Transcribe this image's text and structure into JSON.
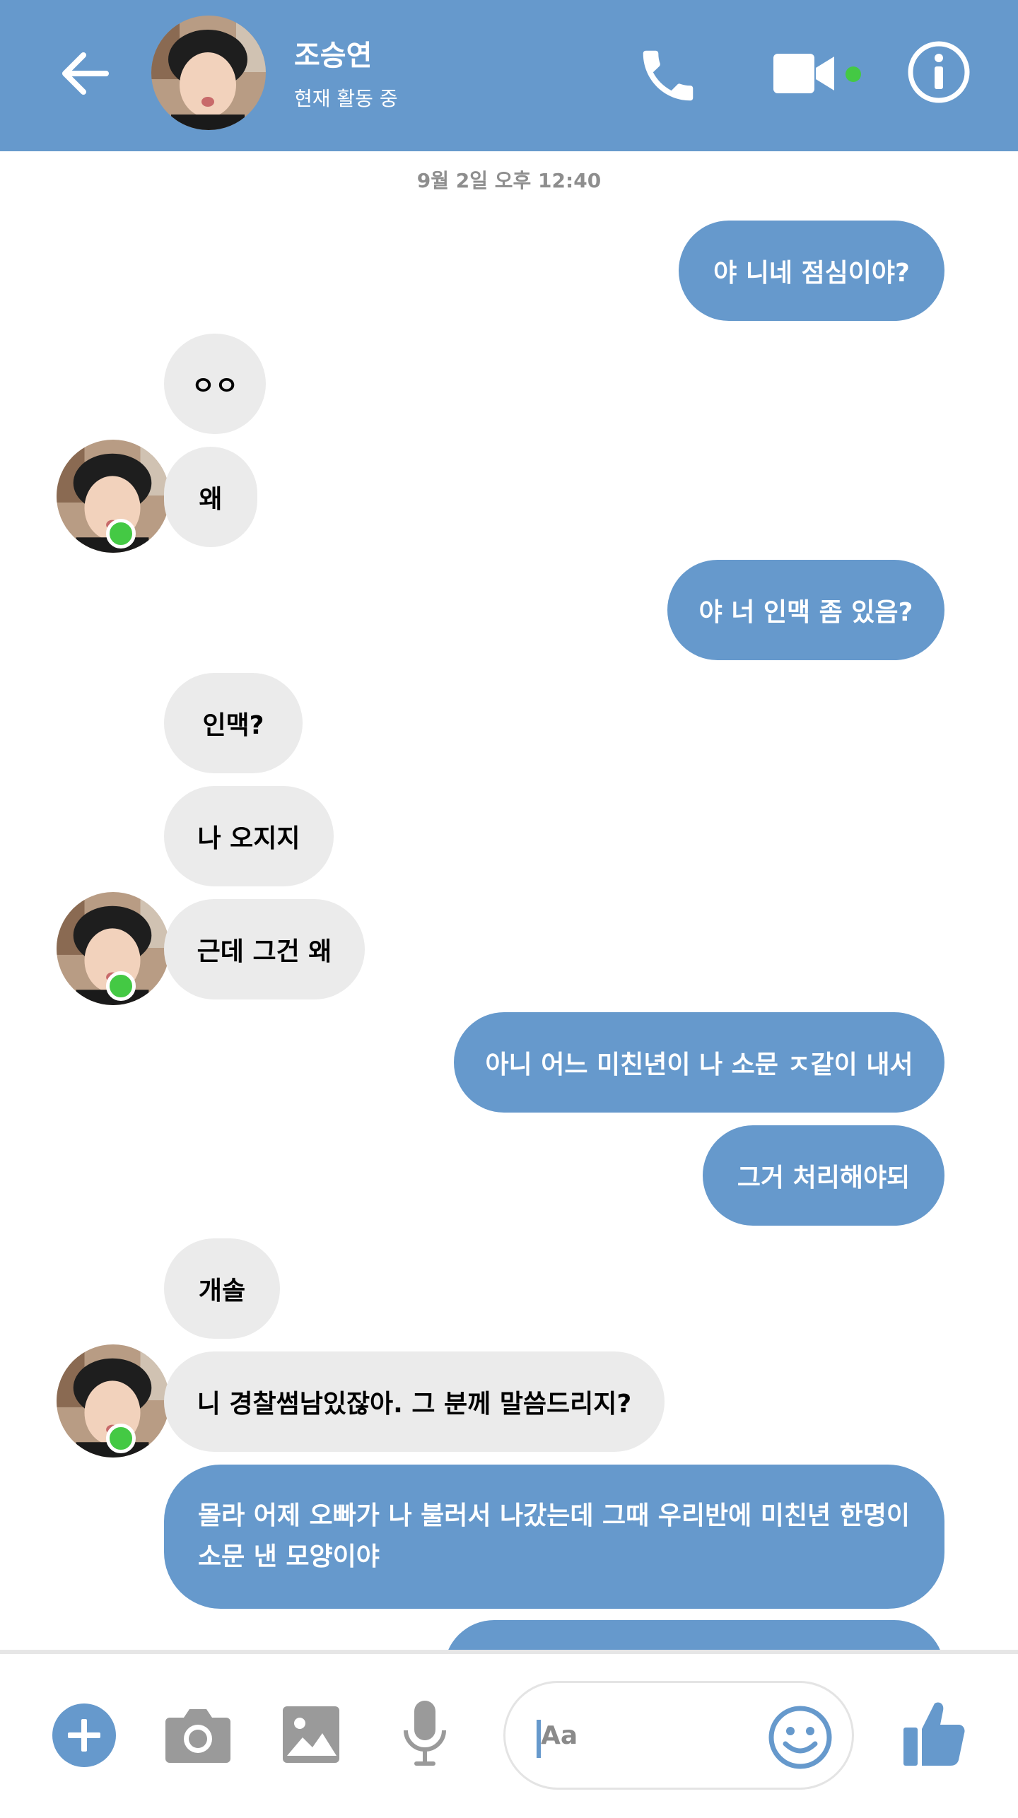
{
  "header": {
    "contact_name": "조승연",
    "contact_status": "현재 활동 중",
    "accent_color": "#6699cc",
    "icons": [
      "back-arrow-icon",
      "phone-icon",
      "video-camera-icon",
      "info-icon"
    ]
  },
  "conversation": {
    "timestamp": "9월 2일 오후 12:40",
    "messages": [
      {
        "direction": "outgoing",
        "text": "야 니네 점심이야?"
      },
      {
        "direction": "incoming",
        "text": "ㅇㅇ"
      },
      {
        "direction": "incoming",
        "text": "왜"
      },
      {
        "direction": "outgoing",
        "text": "야 너 인맥 좀 있음?"
      },
      {
        "direction": "incoming",
        "text": "인맥?"
      },
      {
        "direction": "incoming",
        "text": "나 오지지"
      },
      {
        "direction": "incoming",
        "text": "근데 그건 왜"
      },
      {
        "direction": "outgoing",
        "text": "아니 어느 미친년이 나 소문 ㅈ같이 내서"
      },
      {
        "direction": "outgoing",
        "text": "그거 처리해야되"
      },
      {
        "direction": "incoming",
        "text": "개솔"
      },
      {
        "direction": "incoming",
        "text": "니 경찰썸남있잖아. 그 분께 말씀드리지?"
      },
      {
        "direction": "outgoing",
        "text": "몰라 어제 오빠가 나 불러서 나갔는데 그때 우리반에 미친년 한명이 소문 낸 모양이야"
      },
      {
        "direction": "outgoing",
        "text": ""
      }
    ]
  },
  "composer": {
    "placeholder": "Aa",
    "icons": [
      "plus-icon",
      "camera-icon",
      "image-icon",
      "microphone-icon",
      "emoji-icon",
      "thumbs-up-icon"
    ]
  },
  "colors": {
    "outgoing_bubble": "#6699cc",
    "incoming_bubble": "#ebebeb",
    "online": "#44c944"
  }
}
